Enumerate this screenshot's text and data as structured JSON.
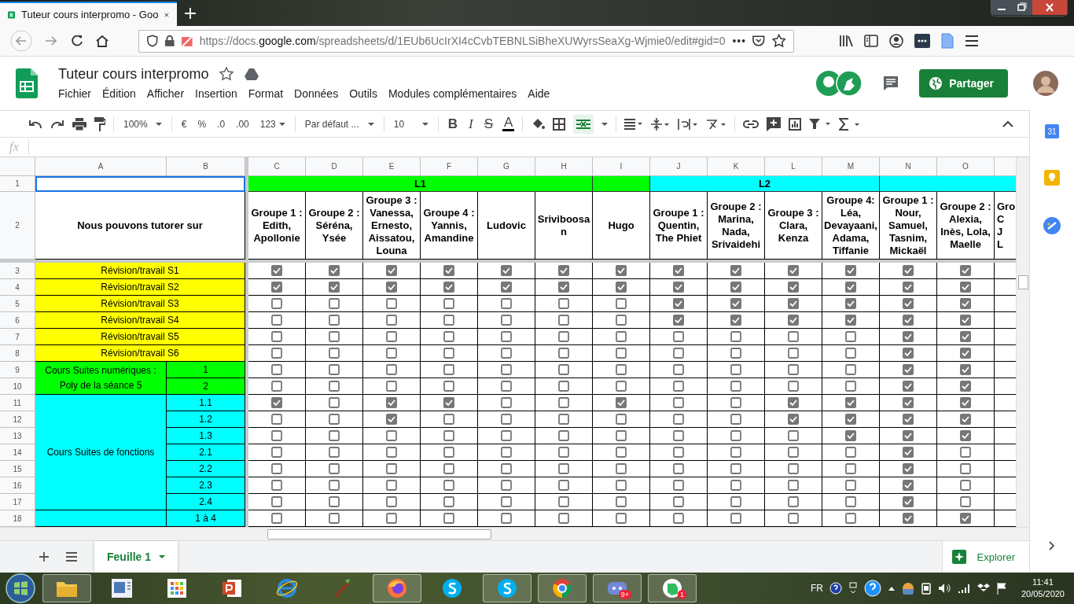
{
  "browser": {
    "tab_title": "Tuteur cours interpromo - Goo",
    "url_pre": "https://docs.",
    "url_host": "google.com",
    "url_post": "/spreadsheets/d/1EUb6UcIrXI4cCvbTEBNLSiBheXUWyrsSeaXg-Wjmie0/edit#gid=0"
  },
  "doc": {
    "title": "Tuteur cours interpromo",
    "menus": [
      "Fichier",
      "Édition",
      "Afficher",
      "Insertion",
      "Format",
      "Données",
      "Outils",
      "Modules complémentaires",
      "Aide"
    ],
    "share": "Partager"
  },
  "toolbar": {
    "zoom": "100%",
    "currency": "€",
    "percent": "%",
    "dec_less": ".0",
    "dec_more": ".00",
    "number_format": "123",
    "font": "Par défaut ...",
    "font_size": "10",
    "bold": "B",
    "italic": "I",
    "strike": "S",
    "text_color": "A"
  },
  "formula_bar": {
    "label": "fx"
  },
  "sheet": {
    "column_letters": [
      "A",
      "B",
      "C",
      "D",
      "E",
      "F",
      "G",
      "H",
      "I",
      "J",
      "K",
      "L",
      "M",
      "N",
      "O"
    ],
    "row_numbers": [
      "1",
      "2",
      "3",
      "4",
      "5",
      "6",
      "7",
      "8",
      "9",
      "10",
      "11",
      "12",
      "13",
      "14",
      "15",
      "16",
      "17",
      "18"
    ],
    "first_cell": {
      "selected": true
    },
    "bands": [
      {
        "label": "L1",
        "color": "#00ff00",
        "headers": [
          "Groupe 1 : Edith, Apollonie",
          "Groupe 2 : Séréna, Ysée",
          "Groupe 3 : Vanessa, Ernesto, Aissatou, Louna",
          "Groupe 4 : Yannis, Amandine",
          "Ludovic",
          "Sriviboosan"
        ]
      },
      {
        "color": "#00ff00",
        "headers": [
          "Hugo"
        ]
      },
      {
        "label": "L2",
        "color": "#00ffff",
        "headers": [
          "Groupe 1 : Quentin, The Phiet",
          "Groupe 2 : Marina, Nada, Srivaidehi",
          "Groupe 3 : Clara, Kenza",
          "Groupe 4: Léa, Devayaani,Adama, Tiffanie"
        ]
      },
      {
        "color": "#00ffff",
        "headers": [
          "Groupe 1 : Nour, Samuel, Tasnim, Mickaël",
          "Groupe 2 : Alexia, Inès, Lola, Maelle",
          "Gro\nC\nJ\nL"
        ]
      }
    ],
    "corner_title": "Nous pouvons tutorer sur",
    "row_groups": [
      {
        "kind": "single",
        "label": "Révision/travail S1",
        "color": "#ffff00",
        "rows": [
          {
            "checked": [
              true,
              true,
              true,
              true,
              true,
              true,
              true,
              true,
              true,
              true,
              true,
              true,
              true
            ]
          }
        ]
      },
      {
        "kind": "single",
        "label": "Révision/travail S2",
        "color": "#ffff00",
        "rows": [
          {
            "checked": [
              true,
              true,
              true,
              true,
              true,
              true,
              true,
              true,
              true,
              true,
              true,
              true,
              true
            ]
          }
        ]
      },
      {
        "kind": "single",
        "label": "Révision/travail S3",
        "color": "#ffff00",
        "rows": [
          {
            "checked": [
              false,
              false,
              false,
              false,
              false,
              false,
              false,
              true,
              true,
              true,
              true,
              true,
              true
            ]
          }
        ]
      },
      {
        "kind": "single",
        "label": "Révision/travail S4",
        "color": "#ffff00",
        "rows": [
          {
            "checked": [
              false,
              false,
              false,
              false,
              false,
              false,
              false,
              true,
              true,
              true,
              true,
              true,
              true
            ]
          }
        ]
      },
      {
        "kind": "single",
        "label": "Révision/travail S5",
        "color": "#ffff00",
        "rows": [
          {
            "checked": [
              false,
              false,
              false,
              false,
              false,
              false,
              false,
              false,
              false,
              false,
              false,
              true,
              true
            ]
          }
        ]
      },
      {
        "kind": "single",
        "label": "Révision/travail S6",
        "color": "#ffff00",
        "rows": [
          {
            "checked": [
              false,
              false,
              false,
              false,
              false,
              false,
              false,
              false,
              false,
              false,
              false,
              true,
              true
            ]
          }
        ]
      },
      {
        "kind": "split",
        "label": "Cours Suites numériques : Poly de la séance 5",
        "color": "#00ff00",
        "rows": [
          {
            "sub": "1",
            "checked": [
              false,
              false,
              false,
              false,
              false,
              false,
              false,
              false,
              false,
              false,
              false,
              true,
              true
            ]
          },
          {
            "sub": "2",
            "checked": [
              false,
              false,
              false,
              false,
              false,
              false,
              false,
              false,
              false,
              false,
              false,
              true,
              true
            ]
          }
        ]
      },
      {
        "kind": "split",
        "label": "Cours Suites de fonctions",
        "color": "#00ffff",
        "rows": [
          {
            "sub": "1.1",
            "checked": [
              true,
              false,
              true,
              true,
              false,
              false,
              true,
              false,
              false,
              true,
              true,
              true,
              true
            ]
          },
          {
            "sub": "1.2",
            "checked": [
              false,
              false,
              true,
              false,
              false,
              false,
              false,
              false,
              false,
              true,
              true,
              true,
              true
            ]
          },
          {
            "sub": "1.3",
            "checked": [
              false,
              false,
              false,
              false,
              false,
              false,
              false,
              false,
              false,
              false,
              true,
              true,
              true
            ]
          },
          {
            "sub": "2.1",
            "checked": [
              false,
              false,
              false,
              false,
              false,
              false,
              false,
              false,
              false,
              false,
              false,
              true,
              false
            ]
          },
          {
            "sub": "2.2",
            "checked": [
              false,
              false,
              false,
              false,
              false,
              false,
              false,
              false,
              false,
              false,
              false,
              true,
              false
            ]
          },
          {
            "sub": "2.3",
            "checked": [
              false,
              false,
              false,
              false,
              false,
              false,
              false,
              false,
              false,
              false,
              false,
              true,
              false
            ]
          },
          {
            "sub": "2.4",
            "checked": [
              false,
              false,
              false,
              false,
              false,
              false,
              false,
              false,
              false,
              false,
              false,
              true,
              false
            ]
          }
        ]
      },
      {
        "kind": "split",
        "color": "#00ffff",
        "rows": [
          {
            "sub": "1 à 4",
            "checked": [
              false,
              false,
              false,
              false,
              false,
              false,
              false,
              false,
              false,
              false,
              false,
              true,
              true
            ]
          }
        ]
      }
    ]
  },
  "sheet_tabs": [
    {
      "label": "Feuille 1",
      "selected": true
    }
  ],
  "explore": "Explorer",
  "side_panel": {
    "calendar_day": "31"
  },
  "taskbar": {
    "apps": [
      {
        "kind": "folder",
        "running": true
      },
      {
        "kind": "presentation",
        "running": false
      },
      {
        "kind": "grid",
        "running": false
      },
      {
        "kind": "slides",
        "running": false
      },
      {
        "kind": "globe",
        "running": false
      },
      {
        "kind": "brush",
        "running": false
      },
      {
        "kind": "fox",
        "running": true
      },
      {
        "kind": "chat",
        "running": false
      },
      {
        "kind": "chat",
        "running": true
      },
      {
        "kind": "wheel",
        "running": true
      },
      {
        "kind": "gamepad",
        "running": true,
        "badge": "9+"
      },
      {
        "kind": "note",
        "running": true,
        "badge": "1"
      }
    ],
    "language": "FR",
    "time": "11:41",
    "date": "20/05/2020"
  }
}
